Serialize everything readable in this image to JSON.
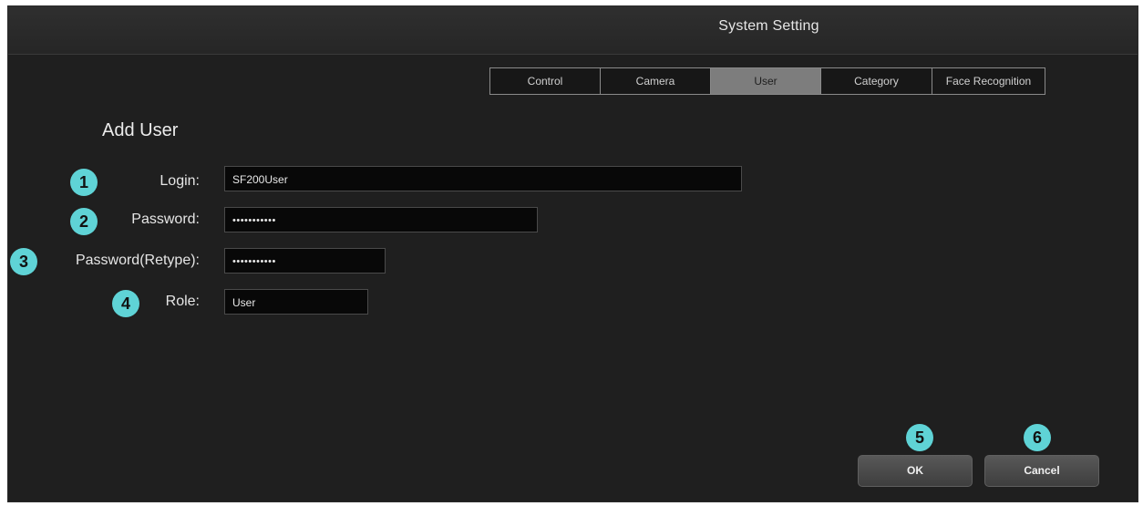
{
  "window": {
    "title": "System Setting"
  },
  "tabs": [
    {
      "label": "Control"
    },
    {
      "label": "Camera"
    },
    {
      "label": "User",
      "active": true
    },
    {
      "label": "Category"
    },
    {
      "label": "Face Recognition"
    }
  ],
  "form": {
    "heading": "Add User",
    "login": {
      "label": "Login:",
      "value": "SF200User",
      "badge": "1"
    },
    "password": {
      "label": "Password:",
      "value": "•••••••••••",
      "badge": "2"
    },
    "password_retype": {
      "label": "Password(Retype):",
      "value": "•••••••••••",
      "badge": "3"
    },
    "role": {
      "label": "Role:",
      "value": "User",
      "badge": "4"
    }
  },
  "buttons": {
    "ok": {
      "label": "OK",
      "badge": "5"
    },
    "cancel": {
      "label": "Cancel",
      "badge": "6"
    }
  },
  "colors": {
    "badge": "#5fd3d6",
    "background": "#1f1f1f",
    "active_tab": "#7d7d7d"
  }
}
